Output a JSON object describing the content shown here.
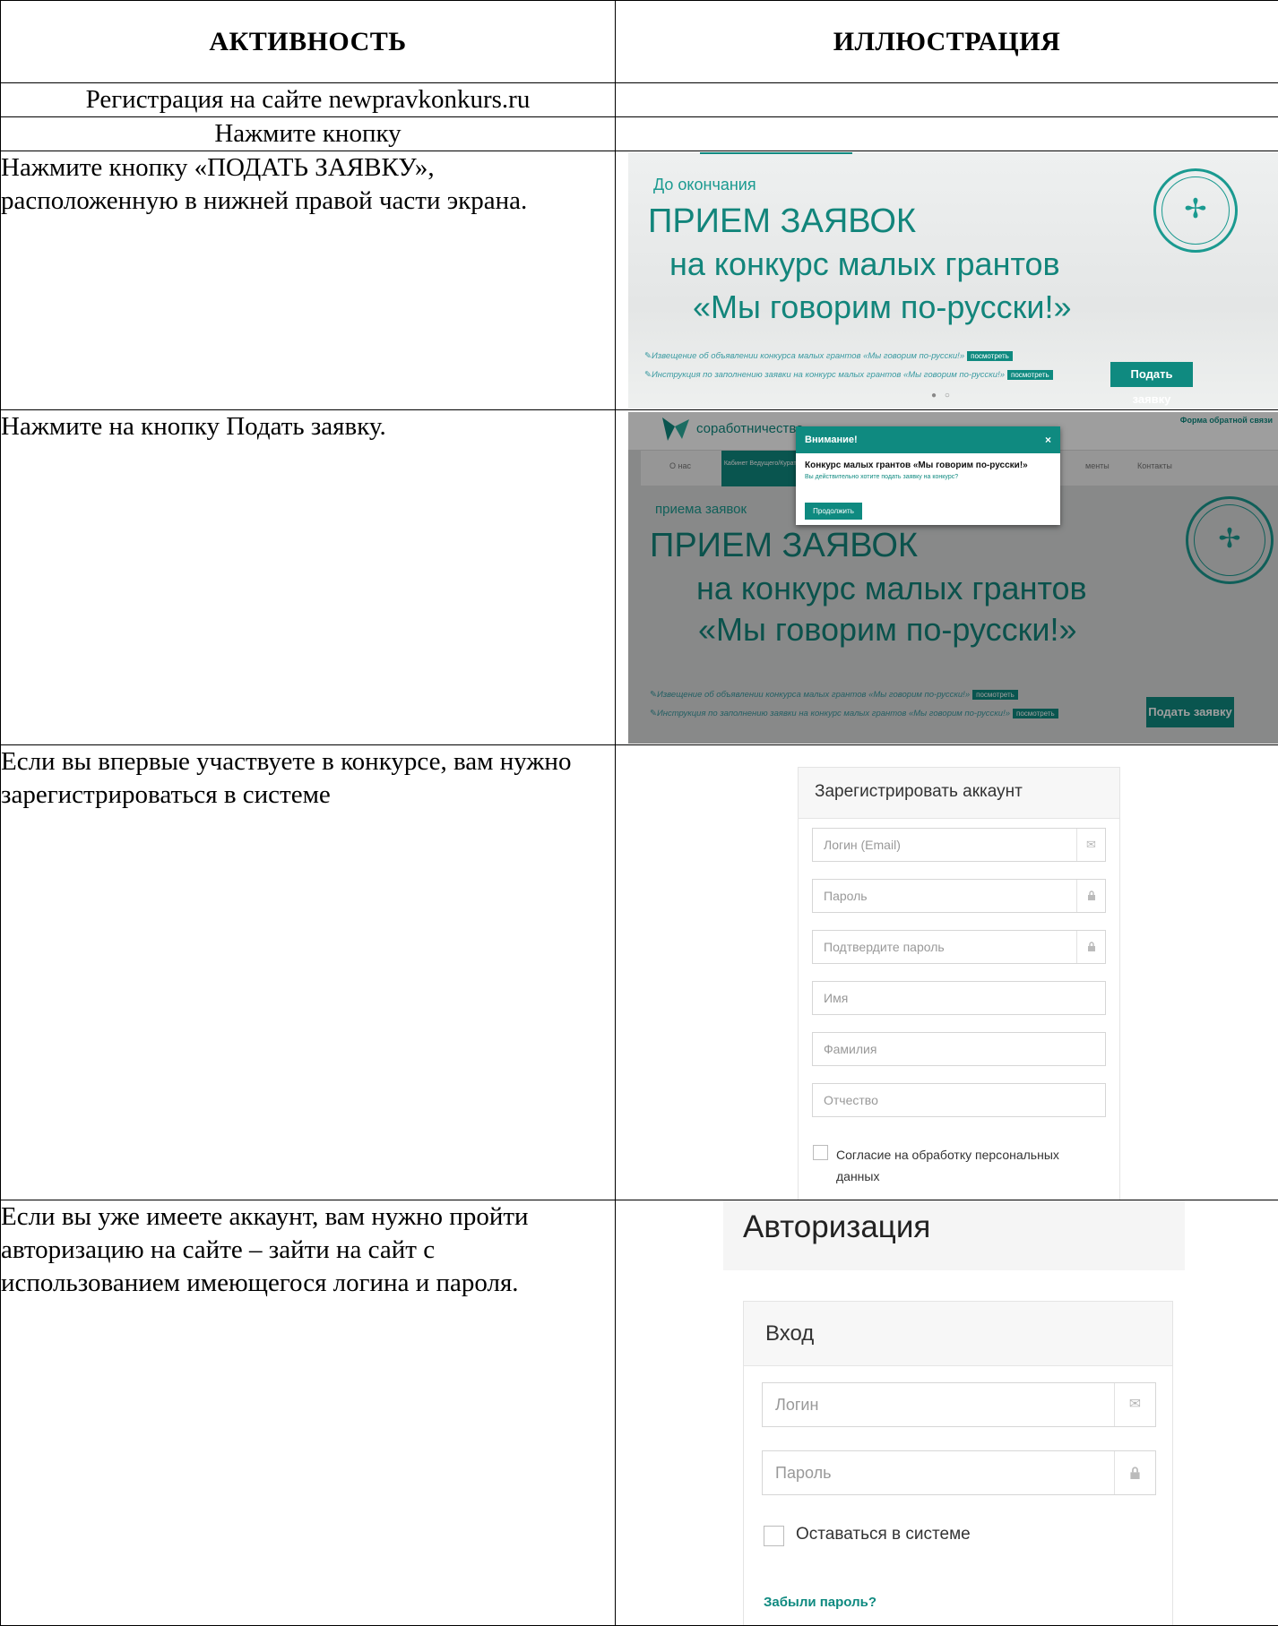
{
  "table": {
    "headers": {
      "activity": "АКТИВНОСТЬ",
      "illustration": "ИЛЛЮСТРАЦИЯ"
    },
    "row1": {
      "activity": "Регистрация на сайте newpravkonkurs.ru"
    },
    "row2": {
      "activity": "Нажмите кнопку"
    },
    "row3": {
      "activity": "Нажмите кнопку «ПОДАТЬ ЗАЯВКУ», расположенную в нижней правой части экрана."
    },
    "row4": {
      "activity": "Нажмите на кнопку Подать заявку."
    },
    "row5": {
      "activity": "Если вы впервые участвуете в конкурсе, вам нужно зарегистрироваться в системе"
    },
    "row6": {
      "activity": "Если вы уже имеете аккаунт, вам нужно пройти авторизацию на сайте – зайти на сайт с использованием имеющегося логина и пароля."
    }
  },
  "slide1": {
    "countdown_label": "До окончания",
    "title_line1": "ПРИЕМ ЗАЯВОК",
    "title_line2": "на конкурс малых грантов",
    "title_line3": "«Мы говорим по-русски!»",
    "link1": "Извещение об объявлении конкурса малых грантов «Мы говорим по-русски!»",
    "link2": "Инструкция по заполнению заявки на конкурс малых грантов «Мы говорим по-русски!»",
    "link_tag": "посмотреть",
    "apply_button": "Подать заявку",
    "dots": "● ○"
  },
  "slide2": {
    "brand": "соработничество",
    "feedback": "Форма обратной связи",
    "nav_about": "О нас",
    "nav_active": "Кабинет Ведущего/Куратора",
    "nav_docs": "менты",
    "nav_contacts": "Контакты",
    "countdown_label": "приема заявок",
    "title_line1": "ПРИЕМ ЗАЯВОК",
    "title_line2": "на конкурс малых грантов",
    "title_line3": "«Мы говорим по-русски!»",
    "link1": "Извещение об объявлении конкурса малых грантов «Мы говорим по-русски!»",
    "link2": "Инструкция по заполнению заявки на конкурс малых грантов «Мы говорим по-русски!»",
    "link_tag": "посмотреть",
    "apply_button": "Подать заявку",
    "modal": {
      "title": "Внимание!",
      "close": "×",
      "heading": "Конкурс малых грантов «Мы говорим по-русски!»",
      "text": "Вы действительно хотите подать заявку на конкурс?",
      "button": "Продолжить"
    }
  },
  "register": {
    "title": "Зарегистрировать аккаунт",
    "login_placeholder": "Логин (Email)",
    "password_placeholder": "Пароль",
    "confirm_placeholder": "Подтвердите пароль",
    "first_name_placeholder": "Имя",
    "last_name_placeholder": "Фамилия",
    "middle_name_placeholder": "Отчество",
    "consent_line1": "Согласие на обработку персональных",
    "consent_line2": "данных",
    "mail_icon": "✉",
    "lock_icon": "🔒"
  },
  "auth": {
    "page_title": "Авторизация",
    "panel_title": "Вход",
    "login_placeholder": "Логин",
    "password_placeholder": "Пароль",
    "remember": "Оставаться в системе",
    "forgot": "Забыли пароль?"
  },
  "colors": {
    "teal": "#0f8a80",
    "teal_light": "#1a9a90"
  }
}
